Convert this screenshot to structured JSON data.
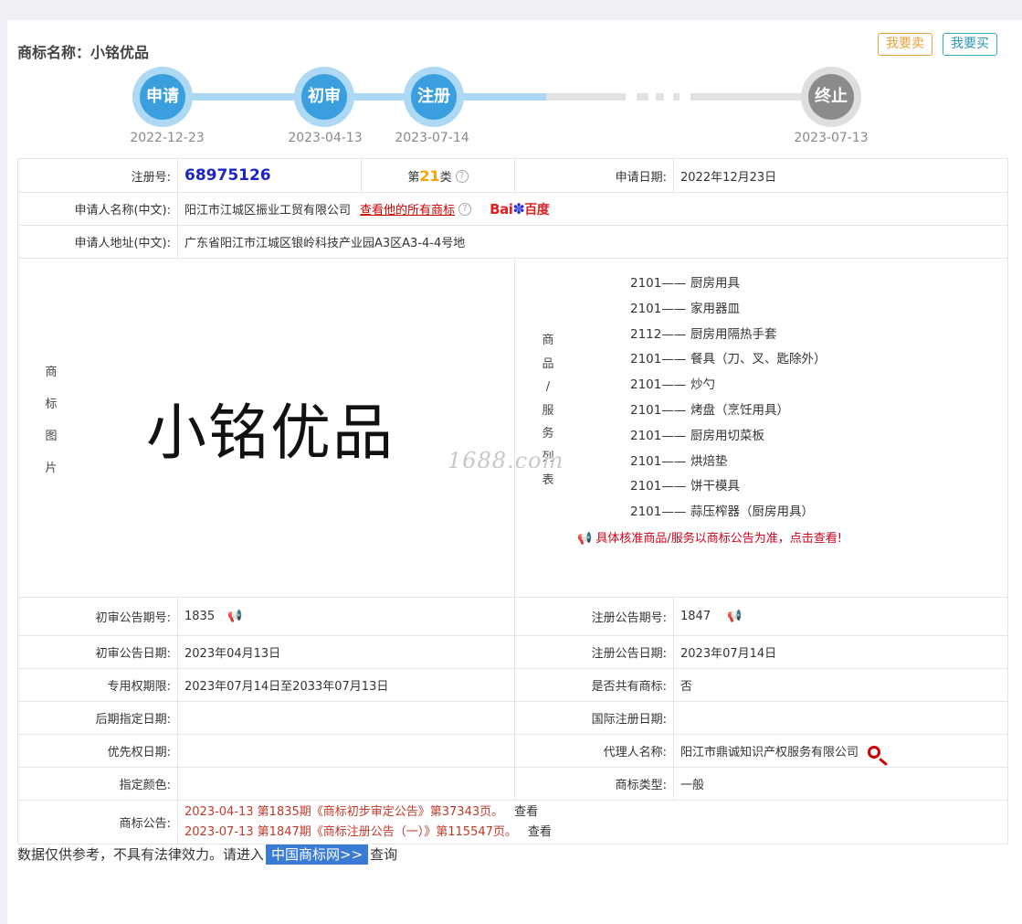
{
  "header": {
    "title_label": "商标名称：",
    "title_value": "小铭优品",
    "sell_label": "我要卖",
    "buy_label": "我要买"
  },
  "timeline": [
    {
      "label": "申请",
      "date": "2022-12-23",
      "state": "active"
    },
    {
      "label": "初审",
      "date": "2023-04-13",
      "state": "active"
    },
    {
      "label": "注册",
      "date": "2023-07-14",
      "state": "active"
    },
    {
      "label": "终止",
      "date": "2023-07-13",
      "state": "inactive"
    }
  ],
  "info": {
    "reg_no_label": "注册号:",
    "reg_no": "68975126",
    "class_prefix": "第",
    "class_num": "21",
    "class_suffix": "类",
    "apply_date_label": "申请日期:",
    "apply_date": "2022年12月23日",
    "applicant_label": "申请人名称(中文):",
    "applicant": "阳江市江城区振业工贸有限公司",
    "view_all_link": "查看他的所有商标",
    "baidu_prefix": "Bai",
    "baidu_suffix": "百度",
    "address_label": "申请人地址(中文):",
    "address": "广东省阳江市江城区银岭科技产业园A3区A3-4-4号地",
    "image_label": [
      "商",
      "标",
      "图",
      "片"
    ],
    "mark_text": "小铭优品",
    "goods_label": [
      "商",
      "品",
      "/",
      "服",
      "务",
      "列",
      "表"
    ],
    "watermark": "1688.com",
    "goods": [
      {
        "code": "2101——",
        "name": "厨房用具"
      },
      {
        "code": "2101——",
        "name": "家用器皿"
      },
      {
        "code": "2112——",
        "name": "厨房用隔热手套"
      },
      {
        "code": "2101——",
        "name": "餐具（刀、叉、匙除外）"
      },
      {
        "code": "2101——",
        "name": "炒勺"
      },
      {
        "code": "2101——",
        "name": "烤盘（烹饪用具）"
      },
      {
        "code": "2101——",
        "name": "厨房用切菜板"
      },
      {
        "code": "2101——",
        "name": "烘焙垫"
      },
      {
        "code": "2101——",
        "name": "饼干模具"
      },
      {
        "code": "2101——",
        "name": "蒜压榨器（厨房用具）"
      }
    ],
    "goods_notice": "具体核准商品/服务以商标公告为准，点击查看!",
    "prelim_no_label": "初审公告期号:",
    "prelim_no": "1835",
    "reg_ann_no_label": "注册公告期号:",
    "reg_ann_no": "1847",
    "prelim_date_label": "初审公告日期:",
    "prelim_date": "2023年04月13日",
    "reg_ann_date_label": "注册公告日期:",
    "reg_ann_date": "2023年07月14日",
    "exclusive_label": "专用权期限:",
    "exclusive": "2023年07月14日至2033年07月13日",
    "shared_label": "是否共有商标:",
    "shared": "否",
    "later_label": "后期指定日期:",
    "later": "",
    "intl_label": "国际注册日期:",
    "intl": "",
    "priority_label": "优先权日期:",
    "priority": "",
    "agent_label": "代理人名称:",
    "agent": "阳江市鼎诚知识产权服务有限公司",
    "color_label": "指定颜色:",
    "color": "",
    "type_label": "商标类型:",
    "type": "一般",
    "announce_label": "商标公告:",
    "announcements": [
      {
        "text": "2023-04-13 第1835期《商标初步审定公告》第37343页。",
        "view": "查看"
      },
      {
        "text": "2023-07-13 第1847期《商标注册公告（一）》第115547页。",
        "view": "查看"
      }
    ]
  },
  "footer": {
    "prefix": "数据仅供参考，不具有法律效力。请进入",
    "link": "中国商标网>>",
    "suffix": "查询"
  },
  "colors": {
    "active": "#3b9fdf",
    "inactive": "#8b8b8b",
    "accent_red": "#c00"
  }
}
